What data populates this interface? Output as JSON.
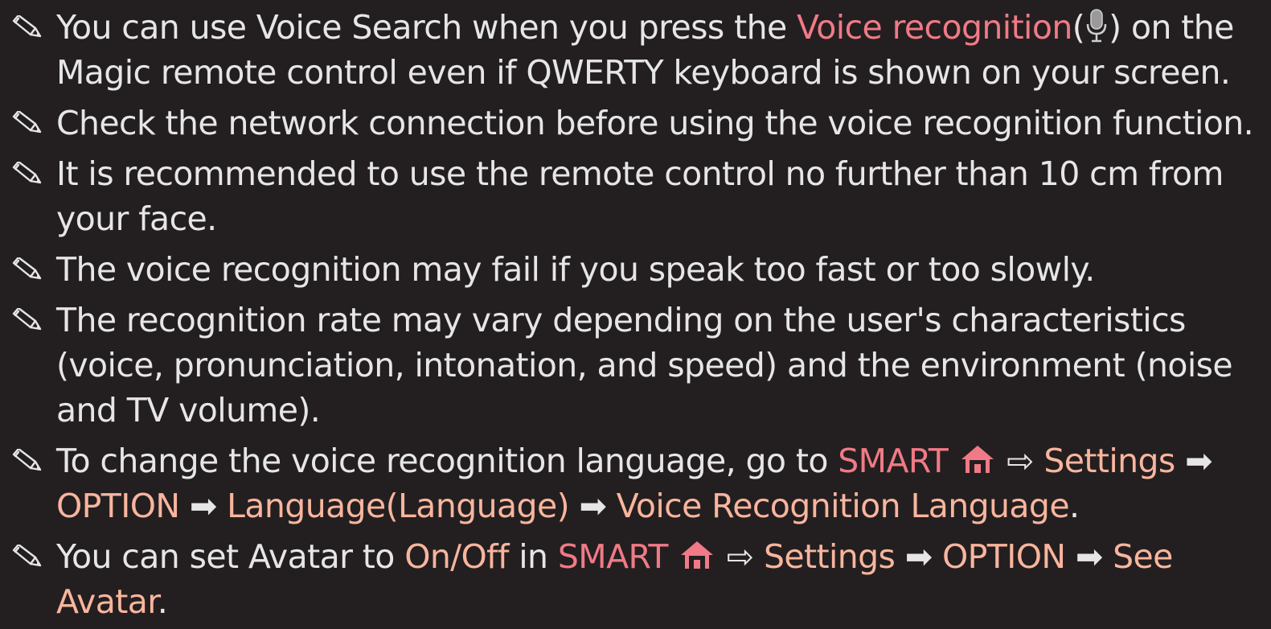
{
  "notes": [
    {
      "before": "You can use Voice Search when you press the ",
      "voice_recognition": "Voice recognition",
      "paren_open": "(",
      "paren_close": ")",
      "after": " on the Magic remote control even if QWERTY keyboard is shown on your screen."
    },
    {
      "text": "Check the network connection before using the voice recognition function."
    },
    {
      "text": "It is recommended to use the remote control no further than 10 cm from your face."
    },
    {
      "text": "The voice recognition may fail if you speak too fast or too slowly."
    },
    {
      "text": "The recognition rate may vary depending on the user's characteristics (voice, pronunciation, intonation, and speed) and the environment (noise and TV volume)."
    },
    {
      "before": "To change the voice recognition language, go to ",
      "smart": "SMART",
      "double_arrow": "⇨",
      "settings": "Settings",
      "arrow": "➡",
      "option": "OPTION",
      "language": "Language(Language)",
      "voice_recognition_language": "Voice Recognition Language",
      "end": "."
    },
    {
      "before": "You can set Avatar to ",
      "on_off": "On/Off",
      "in": " in ",
      "smart": "SMART",
      "double_arrow": "⇨",
      "settings": "Settings",
      "arrow": "➡",
      "option": "OPTION",
      "see_avatar": "See Avatar",
      "end": "."
    }
  ],
  "icons": {
    "bullet": "pencil-icon",
    "mic": "microphone-icon",
    "home": "home-icon"
  },
  "colors": {
    "background": "#231f20",
    "text": "#e6e6e6",
    "highlight_red": "#f07a86",
    "highlight_peach": "#f9b59e"
  }
}
